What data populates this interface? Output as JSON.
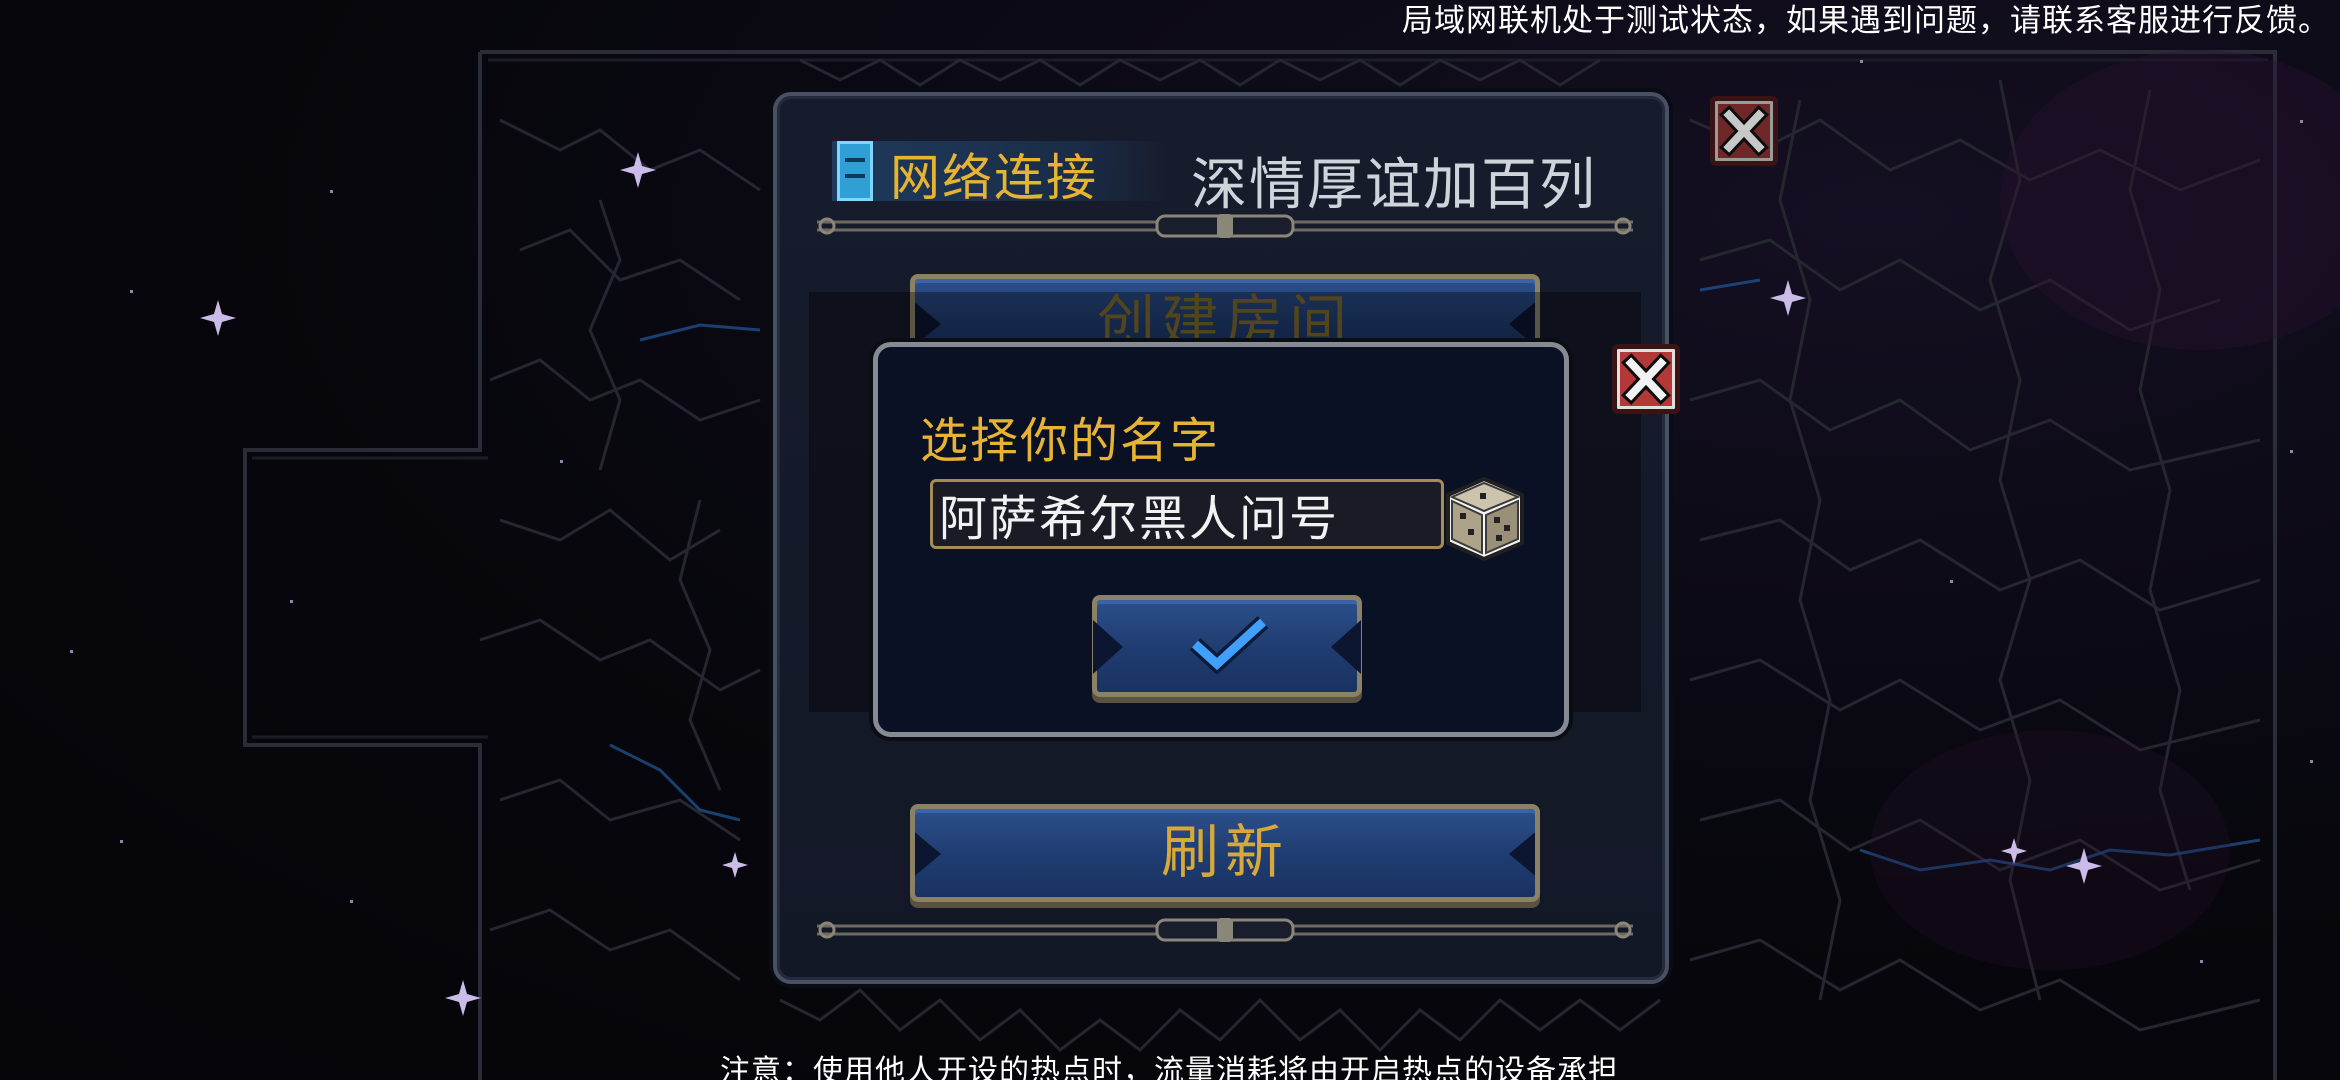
{
  "notices": {
    "top": "局域网联机处于测试状态，如果遇到问题，请联系客服进行反馈。",
    "bottom": "注意：使用他人开设的热点时，流量消耗将由开启热点的设备承担"
  },
  "network_panel": {
    "title": "网络连接",
    "player_name": "深情厚谊加百列",
    "create_room_label": "创建房间",
    "refresh_label": "刷新"
  },
  "name_dialog": {
    "title": "选择你的名字",
    "name_value": "阿萨希尔黑人问号"
  },
  "icons": {
    "close": "close-icon",
    "dice": "dice-icon",
    "confirm": "check-icon",
    "network": "network-icon"
  },
  "colors": {
    "accent_gold": "#e6b333",
    "button_blue": "#1f3c70",
    "close_red": "#b33838",
    "network_blue": "#2f9fd6"
  }
}
